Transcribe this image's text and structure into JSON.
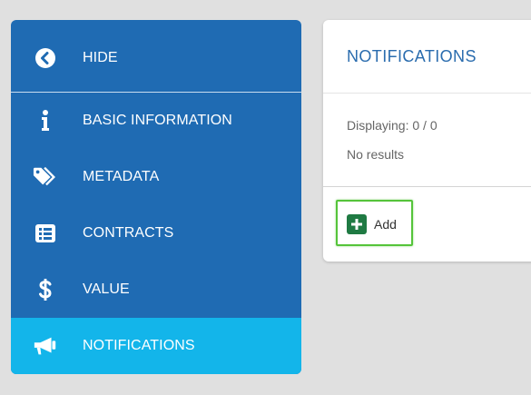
{
  "sidebar": {
    "items": [
      {
        "label": "HIDE",
        "icon": "chevron-left-circle-icon"
      },
      {
        "label": "BASIC INFORMATION",
        "icon": "info-icon"
      },
      {
        "label": "METADATA",
        "icon": "tags-icon"
      },
      {
        "label": "CONTRACTS",
        "icon": "list-icon"
      },
      {
        "label": "VALUE",
        "icon": "dollar-icon"
      },
      {
        "label": "NOTIFICATIONS",
        "icon": "megaphone-icon",
        "active": true
      }
    ],
    "colors": {
      "background": "#1f6bb3",
      "active": "#13b5ea"
    }
  },
  "panel": {
    "title": "NOTIFICATIONS",
    "displaying": "Displaying: 0 / 0",
    "empty_text": "No results",
    "add_label": "Add",
    "colors": {
      "title": "#2a6cae",
      "add_icon": "#1f7a43",
      "focus_border": "#55c43a"
    }
  }
}
